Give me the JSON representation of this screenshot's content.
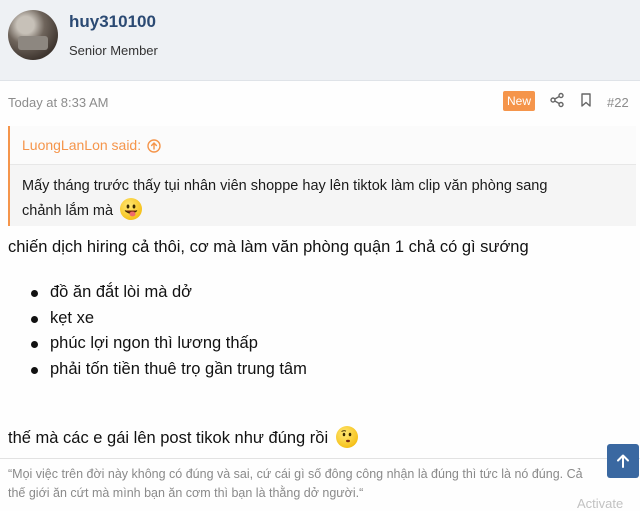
{
  "user": {
    "name": "huy310100",
    "title": "Senior Member"
  },
  "post": {
    "time": "Today at 8:33 AM",
    "badge": "New",
    "number": "#22"
  },
  "quote": {
    "author": "LuongLanLon said:",
    "line1": "Mấy tháng trước thấy tụi nhân viên shoppe hay lên tiktok làm clip văn phòng sang",
    "line2": "chảnh lắm mà"
  },
  "content": {
    "intro": "chiến dịch hiring cả thôi, cơ mà làm văn phòng quận 1 chả có gì sướng",
    "bullets": [
      "đồ ăn đắt lòi mà dở",
      "kẹt xe",
      "phúc lợi ngon thì lương thấp",
      "phải tốn tiền thuê trọ gần trung tâm"
    ],
    "outro": "thế mà các e gái lên post tikok như đúng rồi"
  },
  "signature": {
    "line1": "“Mọi việc trên đời này không có đúng và sai, cứ cái gì số đông công nhận là đúng thì tức là nó đúng. Cả",
    "line2": "thế giới ăn cứt mà mình bạn ăn cơm thì bạn là thằng dở người.“"
  },
  "watermark": "Activate",
  "icons": {
    "share": "share-icon",
    "bookmark": "bookmark-icon",
    "quote_arrow": "arrow-up-circle-icon",
    "scroll_top": "arrow-up-icon"
  },
  "colors": {
    "accent": "#f5954b",
    "username": "#2b4a73",
    "scroll_button": "#3a68a1"
  }
}
